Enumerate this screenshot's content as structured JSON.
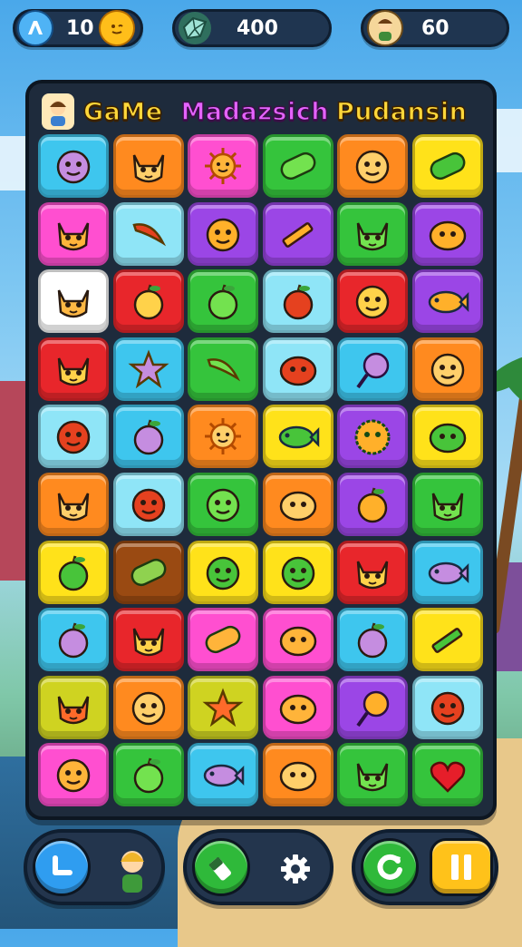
{
  "colors": {
    "blue": "#3ec6ee",
    "orange": "#ff8a1f",
    "pink": "#ff4fd0",
    "green": "#35c43c",
    "yellow": "#ffe21a",
    "purple": "#9b46e6",
    "red": "#e8262b",
    "lightblue": "#8fe5f7",
    "white": "#ffffff",
    "brown": "#9a4a12",
    "olive": "#cfd321"
  },
  "topbar": {
    "left": {
      "icon": "blue-tag-icon",
      "value": "10"
    },
    "middle": {
      "icon": "gem-icon",
      "value": "400"
    },
    "right": {
      "icon": "character-portrait-icon",
      "value": "60"
    }
  },
  "board": {
    "title_words": [
      "GaMe",
      "Madazsich",
      "Pudansin"
    ],
    "rows": [
      [
        {
          "c": "blue",
          "i": "face"
        },
        {
          "c": "orange",
          "i": "cat"
        },
        {
          "c": "pink",
          "i": "sun"
        },
        {
          "c": "green",
          "i": "pill"
        },
        {
          "c": "orange",
          "i": "face"
        },
        {
          "c": "yellow",
          "i": "pill"
        }
      ],
      [
        {
          "c": "pink",
          "i": "cat"
        },
        {
          "c": "lightblue",
          "i": "banana"
        },
        {
          "c": "purple",
          "i": "face"
        },
        {
          "c": "purple",
          "i": "pencil"
        },
        {
          "c": "green",
          "i": "cat"
        },
        {
          "c": "purple",
          "i": "blob"
        }
      ],
      [
        {
          "c": "white",
          "i": "cat"
        },
        {
          "c": "red",
          "i": "fruit"
        },
        {
          "c": "green",
          "i": "fruit"
        },
        {
          "c": "lightblue",
          "i": "fruit"
        },
        {
          "c": "red",
          "i": "face"
        },
        {
          "c": "purple",
          "i": "fish"
        }
      ],
      [
        {
          "c": "red",
          "i": "cat"
        },
        {
          "c": "blue",
          "i": "star"
        },
        {
          "c": "green",
          "i": "banana"
        },
        {
          "c": "lightblue",
          "i": "blob"
        },
        {
          "c": "blue",
          "i": "lollipop"
        },
        {
          "c": "orange",
          "i": "face"
        }
      ],
      [
        {
          "c": "lightblue",
          "i": "face"
        },
        {
          "c": "blue",
          "i": "fruit"
        },
        {
          "c": "orange",
          "i": "sun"
        },
        {
          "c": "yellow",
          "i": "fish"
        },
        {
          "c": "purple",
          "i": "fuzz"
        },
        {
          "c": "yellow",
          "i": "blob"
        }
      ],
      [
        {
          "c": "orange",
          "i": "cat"
        },
        {
          "c": "lightblue",
          "i": "face"
        },
        {
          "c": "green",
          "i": "face"
        },
        {
          "c": "orange",
          "i": "blob"
        },
        {
          "c": "purple",
          "i": "fruit"
        },
        {
          "c": "green",
          "i": "cat"
        }
      ],
      [
        {
          "c": "yellow",
          "i": "fruit"
        },
        {
          "c": "brown",
          "i": "pill"
        },
        {
          "c": "yellow",
          "i": "face"
        },
        {
          "c": "yellow",
          "i": "face"
        },
        {
          "c": "red",
          "i": "cat"
        },
        {
          "c": "blue",
          "i": "fish"
        }
      ],
      [
        {
          "c": "blue",
          "i": "fruit"
        },
        {
          "c": "red",
          "i": "cat"
        },
        {
          "c": "pink",
          "i": "pill"
        },
        {
          "c": "pink",
          "i": "blob"
        },
        {
          "c": "blue",
          "i": "fruit"
        },
        {
          "c": "yellow",
          "i": "pencil"
        }
      ],
      [
        {
          "c": "olive",
          "i": "cat"
        },
        {
          "c": "orange",
          "i": "face"
        },
        {
          "c": "olive",
          "i": "star"
        },
        {
          "c": "pink",
          "i": "blob"
        },
        {
          "c": "purple",
          "i": "lollipop"
        },
        {
          "c": "lightblue",
          "i": "face"
        }
      ],
      [
        {
          "c": "pink",
          "i": "face"
        },
        {
          "c": "green",
          "i": "fruit"
        },
        {
          "c": "blue",
          "i": "fish"
        },
        {
          "c": "orange",
          "i": "blob"
        },
        {
          "c": "green",
          "i": "cat"
        },
        {
          "c": "green",
          "i": "heart"
        }
      ]
    ]
  },
  "bottombar": {
    "left": {
      "button_icon": "check-icon",
      "portrait_icon": "character-portrait-icon"
    },
    "middle": {
      "button_icon": "eraser-icon",
      "settings_icon": "gear-icon"
    },
    "right": {
      "refresh_icon": "refresh-icon",
      "pause_icon": "pause-icon"
    }
  }
}
